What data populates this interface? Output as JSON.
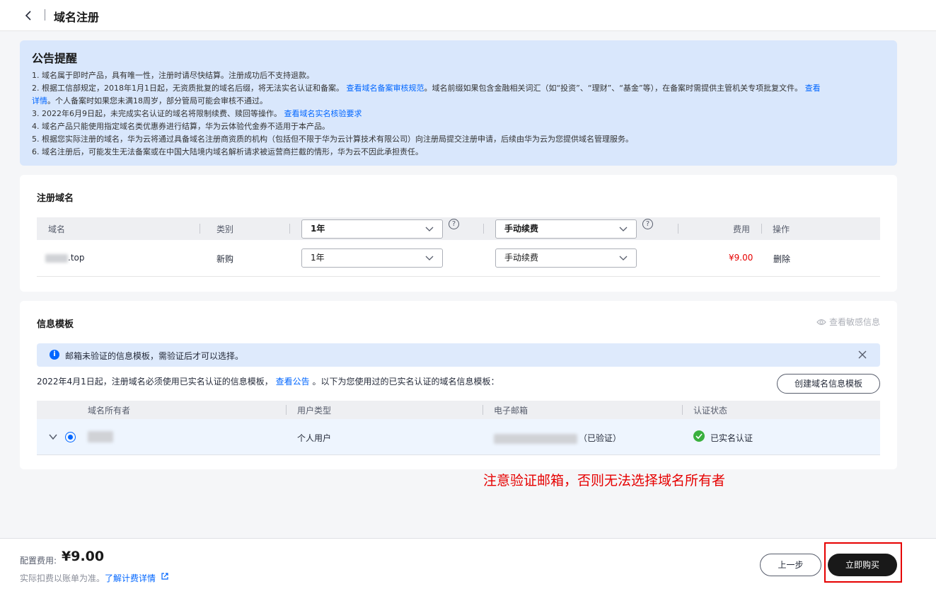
{
  "header": {
    "title": "域名注册"
  },
  "notice": {
    "title": "公告提醒",
    "lines": [
      {
        "pre": "1. 域名属于即时产品，具有唯一性，注册时请尽快结算。注册成功后不支持退款。",
        "link": "",
        "post": ""
      },
      {
        "pre": "2. 根据工信部规定，2018年1月1日起，无资质批复的域名后缀，将无法实名认证和备案。",
        "link": "查看域名备案审核规范",
        "post": "。域名前缀如果包含金融相关词汇（如“投资”、“理财”、“基金”等），在备案时需提供主管机关专项批复文件。",
        "link2": "查看"
      },
      {
        "pre": "",
        "link": "详情",
        "post": "。个人备案时如果您未满18周岁，部分管局可能会审核不通过。"
      },
      {
        "pre": "3. 2022年6月9日起，未完成实名认证的域名将限制续费、赎回等操作。",
        "link": "查看域名实名核验要求",
        "post": ""
      },
      {
        "pre": "4. 域名产品只能使用指定域名类优惠券进行结算，华为云体验代金券不适用于本产品。",
        "link": "",
        "post": ""
      },
      {
        "pre": "5. 根据您实际注册的域名，华为云将通过具备域名注册商资质的机构（包括但不限于华为云计算技术有限公司）向注册局提交注册申请，后续由华为云为您提供域名管理服务。",
        "link": "",
        "post": ""
      },
      {
        "pre": "6. 域名注册后，可能发生无法备案或在中国大陆境内域名解析请求被运营商拦截的情形，华为云不因此承担责任。",
        "link": "",
        "post": ""
      }
    ]
  },
  "register": {
    "title": "注册域名",
    "columns": {
      "domain": "域名",
      "type": "类别",
      "fee": "费用",
      "action": "操作"
    },
    "header_period": "1年",
    "header_renew": "手动续费",
    "help_icon": "?",
    "row": {
      "domain_suffix": ".top",
      "type": "新购",
      "period": "1年",
      "renew": "手动续费",
      "fee": "¥9.00",
      "action": "删除"
    }
  },
  "template": {
    "title": "信息模板",
    "view_sensitive": "查看敏感信息",
    "alert": "邮箱未验证的信息模板，需验证后才可以选择。",
    "desc_pre": "2022年4月1日起，注册域名必须使用已实名认证的信息模板，",
    "desc_link": "查看公告",
    "desc_post": "。以下为您使用过的已实名认证的域名信息模板：",
    "create_button": "创建域名信息模板",
    "columns": {
      "owner": "域名所有者",
      "user_type": "用户类型",
      "email": "电子邮箱",
      "status": "认证状态"
    },
    "row": {
      "user_type": "个人用户",
      "email_suffix": "（已验证）",
      "status": "已实名认证"
    }
  },
  "annotation": "注意验证邮箱，否则无法选择域名所有者",
  "footer": {
    "fee_label": "配置费用:",
    "fee_value": "¥9.00",
    "note": "实际扣费以账单为准。",
    "detail_link": "了解计费详情",
    "prev_button": "上一步",
    "buy_button": "立即购买"
  },
  "colors": {
    "accent": "#0066ff",
    "price": "#e60000",
    "success": "#3ab03e",
    "primary_button": "#191919"
  },
  "icons": [
    "chevron-left-icon",
    "chevron-down-icon",
    "question-icon",
    "eye-icon",
    "info-icon",
    "close-icon",
    "expand-chevron-icon",
    "check-circle-icon",
    "external-link-icon"
  ]
}
